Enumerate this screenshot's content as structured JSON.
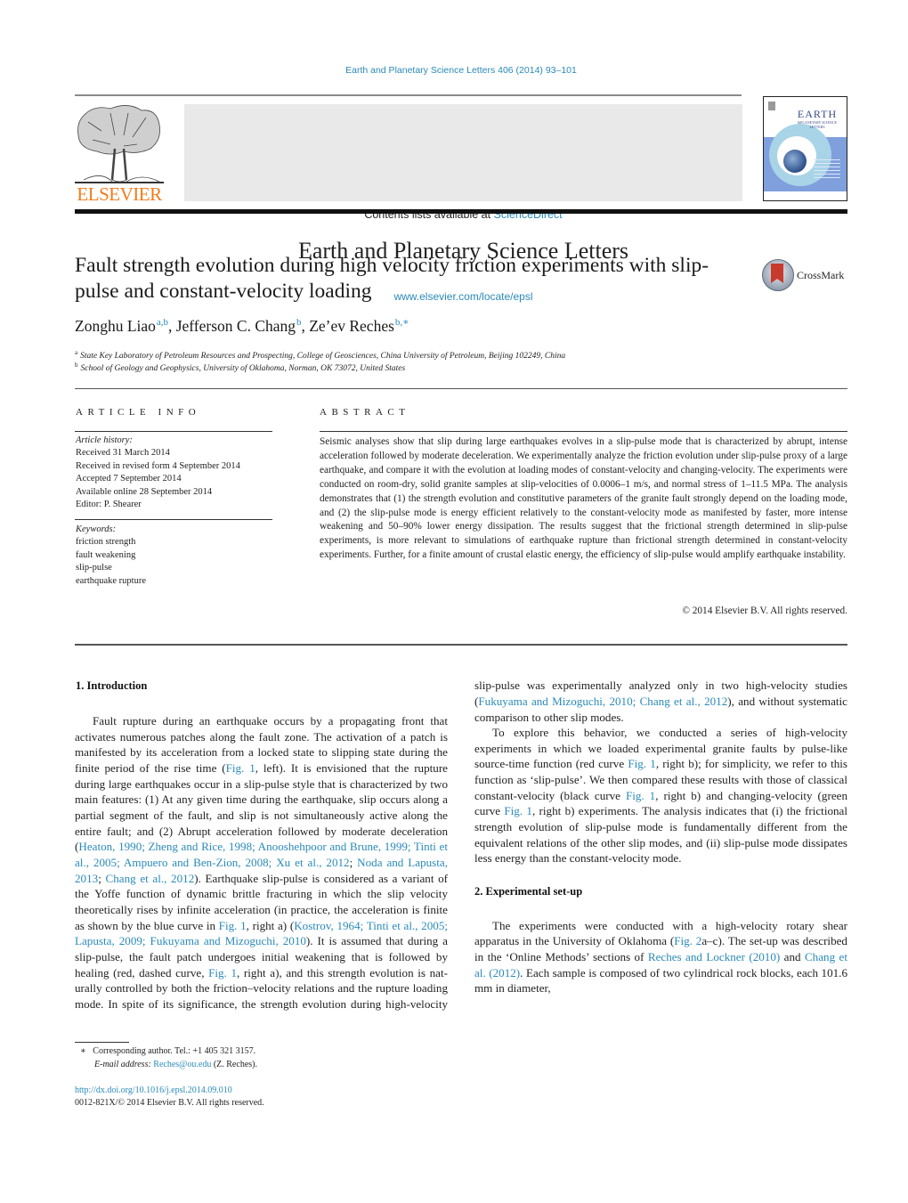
{
  "header": {
    "journal_ref": "Earth and Planetary Science Letters 406 (2014) 93–101",
    "contents_prefix": "Contents lists available at ",
    "contents_link": "ScienceDirect",
    "journal_title": "Earth and Planetary Science Letters",
    "journal_url": "www.elsevier.com/locate/epsl",
    "publisher_logo_text": "ELSEVIER",
    "cover_title": "EARTH",
    "cover_subtitle": "&PLANETARY SCIENCE LETTERS",
    "colors": {
      "link": "#2a8ab8",
      "elsevier_orange": "#f07c1b"
    }
  },
  "article": {
    "title": "Fault strength evolution during high velocity friction experiments with slip-pulse and constant-velocity loading",
    "crossmark_label": "CrossMark",
    "authors": [
      {
        "name": "Zonghu Liao",
        "sup": "a,b"
      },
      {
        "name": "Jefferson C. Chang",
        "sup": "b"
      },
      {
        "name": "Ze’ev Reches",
        "sup": "b,∗"
      }
    ],
    "affiliations": [
      {
        "key": "a",
        "text": "State Key Laboratory of Petroleum Resources and Prospecting, College of Geosciences, China University of Petroleum, Beijing 102249, China"
      },
      {
        "key": "b",
        "text": "School of Geology and Geophysics, University of Oklahoma, Norman, OK 73072, United States"
      }
    ]
  },
  "article_info": {
    "heading": "ARTICLE INFO",
    "history_label": "Article history:",
    "history": [
      "Received 31 March 2014",
      "Received in revised form 4 September 2014",
      "Accepted 7 September 2014",
      "Available online 28 September 2014",
      "Editor: P. Shearer"
    ],
    "keywords_label": "Keywords:",
    "keywords": [
      "friction strength",
      "fault weakening",
      "slip-pulse",
      "earthquake rupture"
    ]
  },
  "abstract": {
    "heading": "ABSTRACT",
    "text": "Seismic analyses show that slip during large earthquakes evolves in a slip-pulse mode that is characterized by abrupt, intense acceleration followed by moderate deceleration. We experimentally analyze the friction evolution under slip-pulse proxy of a large earthquake, and compare it with the evolution at loading modes of constant-velocity and changing-velocity. The experiments were conducted on room-dry, solid granite samples at slip-velocities of 0.0006–1 m/s, and normal stress of 1–11.5 MPa. The analysis demonstrates that (1) the strength evolution and constitutive parameters of the granite fault strongly depend on the loading mode, and (2) the slip-pulse mode is energy efficient relatively to the constant-velocity mode as manifested by faster, more intense weakening and 50–90% lower energy dissipation. The results suggest that the frictional strength determined in slip-pulse experiments, is more relevant to simulations of earthquake rupture than frictional strength determined in constant-velocity experiments. Further, for a finite amount of crustal elastic energy, the efficiency of slip-pulse would amplify earthquake instability.",
    "copyright": "© 2014 Elsevier B.V. All rights reserved."
  },
  "body": {
    "sec1_heading": "1. Introduction",
    "sec1_p1": [
      {
        "t": "Fault rupture during an earthquake occurs by a propagating front that activates numerous patches along the fault zone. The ac­tivation of a patch is manifested by its acceleration from a locked state to slipping state during the finite period of the rise time ("
      },
      {
        "t": "Fig. 1",
        "link": true
      },
      {
        "t": ", left). It is envisioned that the rupture during large earth­quakes occur in a slip-pulse style that is characterized by two main features: (1) At any given time during the earthquake, slip occurs along a partial segment of the fault, and slip is not simultaneously active along the entire fault; and (2) Abrupt acceleration followed by moderate deceleration ("
      },
      {
        "t": "Heaton, 1990; Zheng and Rice, 1998; Anooshehpoor and Brune, 1999; Tinti et al., 2005; Ampuero and Ben-Zion, 2008; Xu et al., 2012",
        "link": true
      },
      {
        "t": "; "
      },
      {
        "t": "Noda and Lapusta, 2013",
        "link": true
      },
      {
        "t": "; "
      },
      {
        "t": "Chang et al., 2012",
        "link": true
      },
      {
        "t": "). Earthquake slip-pulse is considered as a variant of the Yoffe function of dynamic brittle fracturing in which the slip velocity theoretically rises by infinite acceleration (in practice, the acceleration is finite as shown by the blue curve in "
      },
      {
        "t": "Fig. 1",
        "link": true
      },
      {
        "t": ", right a) ("
      },
      {
        "t": "Kostrov, 1964; Tinti et al., 2005; Lapusta, 2009; Fukuyama and Mizoguchi, 2010",
        "link": true
      },
      {
        "t": "). It is assumed that during a slip-pulse, the fault patch undergoes initial weakening that is followed by healing (red, dashed curve, "
      },
      {
        "t": "Fig. 1",
        "link": true
      },
      {
        "t": ", right a), and this strength evolution is nat­urally controlled by both the friction–velocity relations and the rupture loading mode. In spite of its significance, the strength evo­lution during high-velocity slip-pulse was experimentally analyzed only in two high-velocity studies ("
      },
      {
        "t": "Fukuyama and Mizoguchi, 2010; Chang et al., 2012",
        "link": true
      },
      {
        "t": "), and without systematic comparison to other slip modes."
      }
    ],
    "sec1_p2": [
      {
        "t": "To explore this behavior, we conducted a series of high-velocity experiments in which we loaded experimental granite faults by pulse-like source-time function (red curve "
      },
      {
        "t": "Fig. 1",
        "link": true
      },
      {
        "t": ", right b); for sim­plicity, we refer to this function as ‘slip-pulse’. We then compared these results with those of classical constant-velocity (black curve "
      },
      {
        "t": "Fig. 1",
        "link": true
      },
      {
        "t": ", right b) and changing-velocity (green curve "
      },
      {
        "t": "Fig. 1",
        "link": true
      },
      {
        "t": ", right b) experiments. The analysis indicates that (i) the frictional strength evolution of slip-pulse mode is fundamentally different from the equivalent relations of the other slip modes, and (ii) slip-pulse mode dissipates less energy than the constant-velocity mode."
      }
    ],
    "sec2_heading": "2. Experimental set-up",
    "sec2_p1": [
      {
        "t": "The experiments were conducted with a high-velocity rotary shear apparatus in the University of Oklahoma ("
      },
      {
        "t": "Fig. 2",
        "link": true
      },
      {
        "t": "a–c). The set-up was described in the ‘Online Methods’ sections of "
      },
      {
        "t": "Reches and Lockner (2010)",
        "link": true
      },
      {
        "t": " and "
      },
      {
        "t": "Chang et al. (2012)",
        "link": true
      },
      {
        "t": ". Each sample is com­posed of two cylindrical rock blocks, each 101.6 mm in diameter,"
      }
    ]
  },
  "footnotes": {
    "star": "∗",
    "corresponding": "Corresponding author. Tel.: +1 405 321 3157.",
    "email_label": "E-mail address: ",
    "email": "Reches@ou.edu",
    "email_suffix": " (Z. Reches).",
    "doi": "http://dx.doi.org/10.1016/j.epsl.2014.09.010",
    "issn": "0012-821X/© 2014 Elsevier B.V. All rights reserved."
  }
}
